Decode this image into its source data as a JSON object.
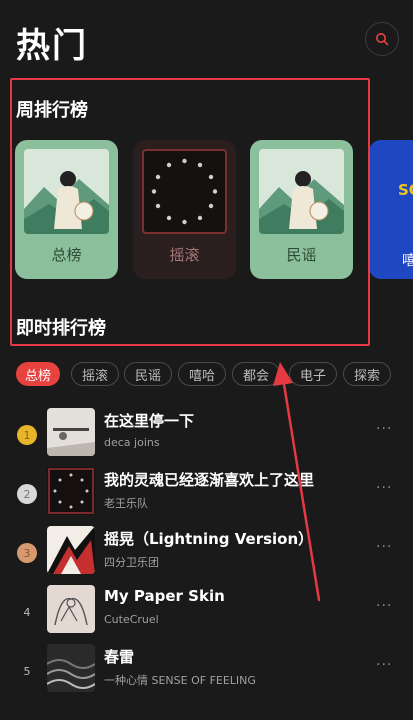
{
  "header": {
    "title": "热门",
    "search_icon": "search-icon"
  },
  "weekly": {
    "title": "周排行榜",
    "cards": [
      {
        "label": "总榜",
        "style": "green"
      },
      {
        "label": "摇滚",
        "style": "rock"
      },
      {
        "label": "民谣",
        "style": "green"
      },
      {
        "label": "SO…噢",
        "style": "blue",
        "line1": "SO",
        "line2": "嘻"
      }
    ]
  },
  "realtime": {
    "title": "即时排行榜"
  },
  "tabs": [
    "总榜",
    "摇滚",
    "民谣",
    "嘻哈",
    "都会",
    "电子",
    "探索"
  ],
  "active_tab": "总榜",
  "songs": [
    {
      "rank": "1",
      "title": "在这里停一下",
      "artist": "deca joins"
    },
    {
      "rank": "2",
      "title": "我的灵魂已经逐渐喜欢上了这里",
      "artist": "老王乐队"
    },
    {
      "rank": "3",
      "title": "摇晃（Lightning Version）",
      "artist": "四分卫乐团"
    },
    {
      "rank": "4",
      "title": "My Paper Skin",
      "artist": "CuteCruel"
    },
    {
      "rank": "5",
      "title": "春雷",
      "artist": "一种心情 SENSE OF FEELING"
    }
  ],
  "more_label": "···",
  "colors": {
    "accent": "#e8423f",
    "annotation": "#e53943",
    "card_green": "#8cbf9b",
    "gold": "#e6b52a",
    "silver": "#d8d8d8",
    "bronze": "#d79a6e"
  }
}
